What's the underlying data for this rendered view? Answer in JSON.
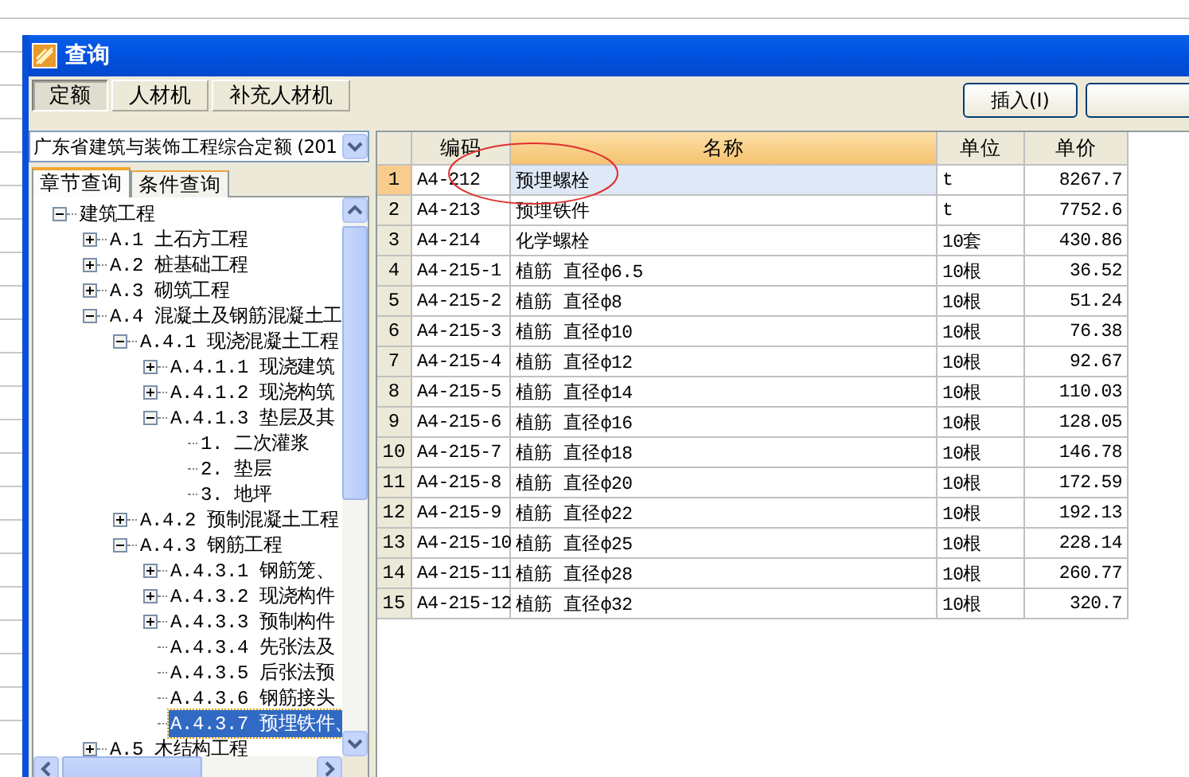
{
  "window": {
    "title": "查询"
  },
  "tabs": [
    {
      "label": "定额",
      "selected": true
    },
    {
      "label": "人材机",
      "selected": false
    },
    {
      "label": "补充人材机",
      "selected": false
    }
  ],
  "buttons": [
    {
      "kind": "labeled",
      "label": "插入(I)"
    },
    {
      "kind": "blank"
    }
  ],
  "library_select": {
    "value": "广东省建筑与装饰工程综合定额 (201"
  },
  "sub_tabs": [
    {
      "label": "章节查询",
      "selected": true
    },
    {
      "label": "条件查询",
      "selected": false
    }
  ],
  "tree": [
    {
      "label": "建筑工程",
      "expanded": true,
      "selected": false,
      "children": [
        {
          "label": "A.1 土石方工程",
          "expanded": false,
          "selected": false
        },
        {
          "label": "A.2 桩基础工程",
          "expanded": false,
          "selected": false
        },
        {
          "label": "A.3 砌筑工程",
          "expanded": false,
          "selected": false
        },
        {
          "label": "A.4 混凝土及钢筋混凝土工",
          "expanded": true,
          "selected": false,
          "children": [
            {
              "label": "A.4.1 现浇混凝土工程",
              "expanded": true,
              "selected": false,
              "children": [
                {
                  "label": "A.4.1.1 现浇建筑",
                  "expanded": false,
                  "selected": false
                },
                {
                  "label": "A.4.1.2 现浇构筑",
                  "expanded": false,
                  "selected": false
                },
                {
                  "label": "A.4.1.3 垫层及其",
                  "expanded": true,
                  "selected": false,
                  "children": [
                    {
                      "label": "1. 二次灌浆",
                      "selected": false
                    },
                    {
                      "label": "2. 垫层",
                      "selected": false
                    },
                    {
                      "label": "3. 地坪",
                      "selected": false
                    }
                  ]
                }
              ]
            },
            {
              "label": "A.4.2 预制混凝土工程",
              "expanded": false,
              "selected": false
            },
            {
              "label": "A.4.3 钢筋工程",
              "expanded": true,
              "selected": false,
              "children": [
                {
                  "label": "A.4.3.1 钢筋笼、",
                  "expanded": false,
                  "selected": false
                },
                {
                  "label": "A.4.3.2 现浇构件",
                  "expanded": false,
                  "selected": false
                },
                {
                  "label": "A.4.3.3 预制构件",
                  "expanded": false,
                  "selected": false
                },
                {
                  "label": "A.4.3.4 先张法及",
                  "selected": false
                },
                {
                  "label": "A.4.3.5 后张法预",
                  "selected": false
                },
                {
                  "label": "A.4.3.6 钢筋接头",
                  "selected": false
                },
                {
                  "label": "A.4.3.7 预埋铁件、",
                  "selected": true
                }
              ]
            }
          ]
        },
        {
          "label": "A.5 木结构工程",
          "expanded": false,
          "selected": false
        }
      ]
    }
  ],
  "table": {
    "columns": [
      {
        "label": "编码",
        "selected": false
      },
      {
        "label": "名称",
        "selected": true
      },
      {
        "label": "单位",
        "selected": false
      },
      {
        "label": "单价",
        "selected": false
      }
    ],
    "rows": [
      {
        "num": "1",
        "code": "A4-212",
        "name": "预埋螺栓",
        "unit": "t",
        "price": "8267.7",
        "selected": true
      },
      {
        "num": "2",
        "code": "A4-213",
        "name": "预埋铁件",
        "unit": "t",
        "price": "7752.6",
        "selected": false
      },
      {
        "num": "3",
        "code": "A4-214",
        "name": "化学螺栓",
        "unit": "10套",
        "price": "430.86",
        "selected": false
      },
      {
        "num": "4",
        "code": "A4-215-1",
        "name": "植筋 直径ф6.5",
        "unit": "10根",
        "price": "36.52",
        "selected": false
      },
      {
        "num": "5",
        "code": "A4-215-2",
        "name": "植筋 直径ф8",
        "unit": "10根",
        "price": "51.24",
        "selected": false
      },
      {
        "num": "6",
        "code": "A4-215-3",
        "name": "植筋 直径ф10",
        "unit": "10根",
        "price": "76.38",
        "selected": false
      },
      {
        "num": "7",
        "code": "A4-215-4",
        "name": "植筋 直径ф12",
        "unit": "10根",
        "price": "92.67",
        "selected": false
      },
      {
        "num": "8",
        "code": "A4-215-5",
        "name": "植筋 直径ф14",
        "unit": "10根",
        "price": "110.03",
        "selected": false
      },
      {
        "num": "9",
        "code": "A4-215-6",
        "name": "植筋 直径ф16",
        "unit": "10根",
        "price": "128.05",
        "selected": false
      },
      {
        "num": "10",
        "code": "A4-215-7",
        "name": "植筋 直径ф18",
        "unit": "10根",
        "price": "146.78",
        "selected": false
      },
      {
        "num": "11",
        "code": "A4-215-8",
        "name": "植筋 直径ф20",
        "unit": "10根",
        "price": "172.59",
        "selected": false
      },
      {
        "num": "12",
        "code": "A4-215-9",
        "name": "植筋 直径ф22",
        "unit": "10根",
        "price": "192.13",
        "selected": false
      },
      {
        "num": "13",
        "code": "A4-215-10",
        "name": "植筋 直径ф25",
        "unit": "10根",
        "price": "228.14",
        "selected": false
      },
      {
        "num": "14",
        "code": "A4-215-11",
        "name": "植筋 直径ф28",
        "unit": "10根",
        "price": "260.77",
        "selected": false
      },
      {
        "num": "15",
        "code": "A4-215-12",
        "name": "植筋 直径ф32",
        "unit": "10根",
        "price": "320.7",
        "selected": false
      }
    ]
  },
  "annotation": {
    "kind": "ellipse"
  }
}
